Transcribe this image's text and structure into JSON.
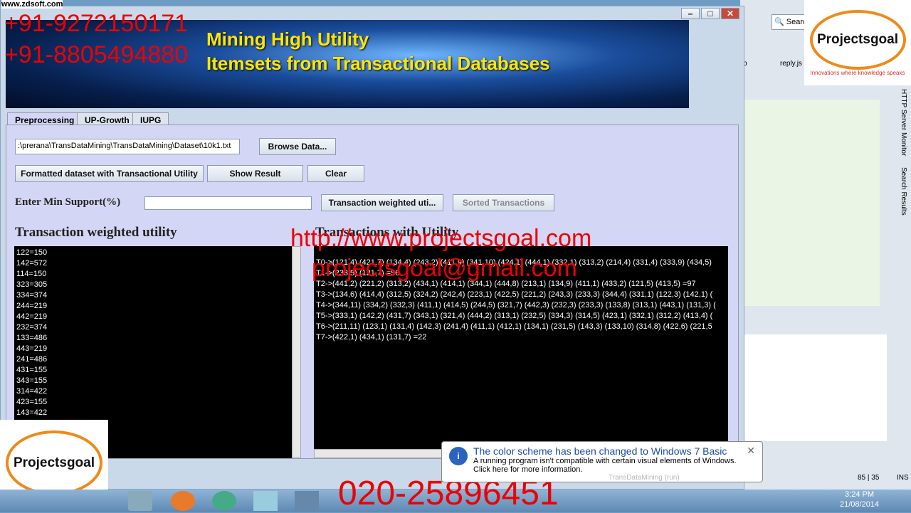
{
  "watermark": {
    "site": "www.zdsoft.com",
    "phone1": "+91-9272150171",
    "phone2": "+91-8805494880",
    "url": "http://www.projectsgoal.com",
    "email": "projectsgoal@gmail.com",
    "landline": "020-25896451",
    "logo_text": "Projectsgoal",
    "logo_tagline": "Innovations where knowledge speaks"
  },
  "banner": {
    "line1": "Mining High Utility",
    "line2": "Itemsets from Transactional Databases"
  },
  "tabs": [
    "Preprocessing",
    "UP-Growth",
    "IUPG"
  ],
  "path_value": ":\\prerana\\TransDataMining\\TransDataMining\\Dataset\\10k1.txt",
  "buttons": {
    "browse": "Browse Data...",
    "formatted": "Formatted dataset with Transactional Utility",
    "show": "Show Result",
    "clear": "Clear",
    "twu": "Transaction weighted uti...",
    "sorted": "Sorted Transactions"
  },
  "min_support_label": "Enter Min Support(%)",
  "min_support_value": "",
  "twu_title": "Transaction weighted utility",
  "twu_list": [
    "122=150",
    "142=572",
    "114=150",
    "323=305",
    "334=374",
    "244=219",
    "442=219",
    "232=374",
    "133=486",
    "443=219",
    "241=486",
    "431=155",
    "343=155",
    "314=422",
    "423=155",
    "143=422"
  ],
  "trans_title": "Transactions with Utility",
  "transactions": [
    "T0->(121,4) (421,7) (134,4) (243,2) (411,9) (341,10) (424,1) (444,1) (332,1) (313,2) (214,4) (331,4) (333,9) (434,5)",
    "T1->(233,5) (121,7) =56",
    "T2->(441,2) (221,2) (313,2) (434,1) (414,1) (344,1) (444,8) (213,1) (134,9) (411,1) (433,2) (121,5) (413,5) =97",
    "T3->(134,6) (414,4) (312,5) (324,2) (242,4) (223,1) (422,5) (221,2) (243,3) (233,3) (344,4) (331,1) (122,3) (142,1) (",
    "T4->(344,11) (334,2) (332,3) (411,1) (414,5) (244,5) (321,7) (442,3) (232,3) (233,3) (133,8) (313,1) (443,1) (131,3) (",
    "T5->(333,1) (142,2) (431,7) (343,1) (321,4) (444,2) (313,1) (232,5) (334,3) (314,5) (423,1) (332,1) (312,2) (413,4) (",
    "T6->(211,11) (123,1) (131,4) (142,3) (241,4) (411,1) (412,1) (134,1) (231,5) (143,3) (133,10) (314,8) (422,6) (221,5",
    "T7->(422,1) (434,1) (131,7) =22"
  ],
  "ide": {
    "search": "Search",
    "tab1": "p",
    "tab2": "reply.js",
    "side1": "HTTP Server Monitor",
    "side2": "Search Results",
    "status_pos": "85 | 35",
    "status_mode": "INS",
    "run": "TransDataMining (run)"
  },
  "balloon": {
    "title": "The color scheme has been changed to Windows 7 Basic",
    "line1": "A running program isn't compatible with certain visual elements of Windows.",
    "line2": "Click here for more information."
  },
  "clock": {
    "time": "3:24 PM",
    "date": "21/08/2014"
  }
}
